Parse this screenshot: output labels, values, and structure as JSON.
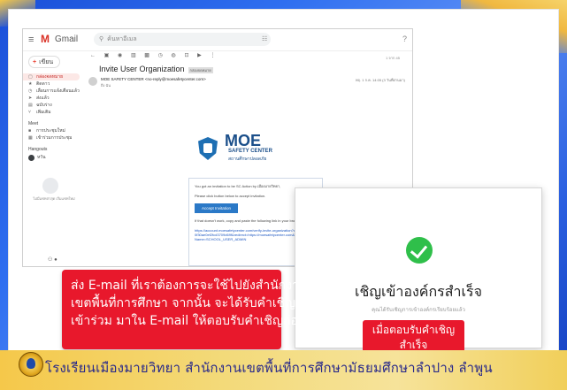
{
  "colors": {
    "background_blue": "#2f6ff0",
    "accent_red": "#e8182c",
    "success_green": "#2fbf4a",
    "gmail_red": "#d93025",
    "footer_band": "#f3da7a"
  },
  "gmail": {
    "menu_icon": "hamburger-icon",
    "app_name": "Gmail",
    "search_placeholder": "ค้นหาอีเมล",
    "compose_label": "เขียน",
    "sidebar": [
      {
        "icon": "inbox-icon",
        "label": "กล่องจดหมาย"
      },
      {
        "icon": "star-icon",
        "label": "ติดดาว"
      },
      {
        "icon": "clock-icon",
        "label": "เลื่อนการแจ้งเตือนแล้ว"
      },
      {
        "icon": "send-icon",
        "label": "ส่งแล้ว"
      },
      {
        "icon": "draft-icon",
        "label": "ฉบับร่าง"
      },
      {
        "icon": "chevron-down-icon",
        "label": "เพิ่มเติม"
      }
    ],
    "meet_label": "Meet",
    "meet_items": [
      {
        "icon": "video-icon",
        "label": "การประชุมใหม่"
      },
      {
        "icon": "keyboard-icon",
        "label": "เข้าร่วมการประชุม"
      }
    ],
    "hangouts_label": "Hangouts",
    "hangouts_user": "หวัน",
    "hangouts_empty": "ไม่มีแชทล่าสุด เริ่มแชทใหม่",
    "toolbar_icons": [
      "back-icon",
      "archive-icon",
      "report-icon",
      "delete-icon",
      "mail-icon",
      "clock-icon",
      "check-icon",
      "move-icon",
      "label-icon",
      "more-icon"
    ],
    "pager": "1 จาก 45",
    "subject": "Invite User Organization",
    "subject_tag": "กล่องจดหมาย",
    "sender": "MOE SAFETY CENTER <no-reply@moesafetycenter.com>",
    "to": "ถึง ฉัน",
    "time": "พฤ. 1 ก.ค. 14:05 (3 วันที่ผ่านมา)",
    "moe_logo": {
      "title": "MOE",
      "subtitle": "SAFETY CENTER",
      "thai": "สถานศึกษาปลอดภัย"
    },
    "card": {
      "line1": "You got an invitation to be SC Action by เมืองมายวิทยา,",
      "line2": "Please click button below to accept invitation.",
      "button": "Accept Invitation",
      "line3": "If that doesn't work, copy and paste the following link in your browser:",
      "link": "https://account.moesafetycenter.com/verify-invite-organization?code=0c93ea0f30ae0ef2fcd3709d69f&redirect=https://moesafetycenter.com&email=...&roleName=SCHOOL_USER_ADMIN"
    }
  },
  "popup": {
    "icon": "check-circle-icon",
    "title": "เชิญเข้าองค์กรสำเร็จ",
    "subtitle": "คุณได้รับเชิญการเข้าองค์กรเรียบร้อยแล้ว"
  },
  "callout_main": [
    "ส่ง E-mail ที่เราต้องการจะใช้ไปยังสำนักงาน",
    "เขตพื้นที่การศึกษา จากนั้น จะได้รับคำเชิญ",
    "เข้าร่วม มาใน E-mail ให้ตอบรับคำเชิญก่อน"
  ],
  "callout_result": [
    "เมื่อตอบรับคำเชิญ",
    "สำเร็จ"
  ],
  "footer": "โรงเรียนเมืองมายวิทยา  สำนักงานเขตพื้นที่การศึกษามัธยมศึกษาลำปาง  ลำพูน"
}
